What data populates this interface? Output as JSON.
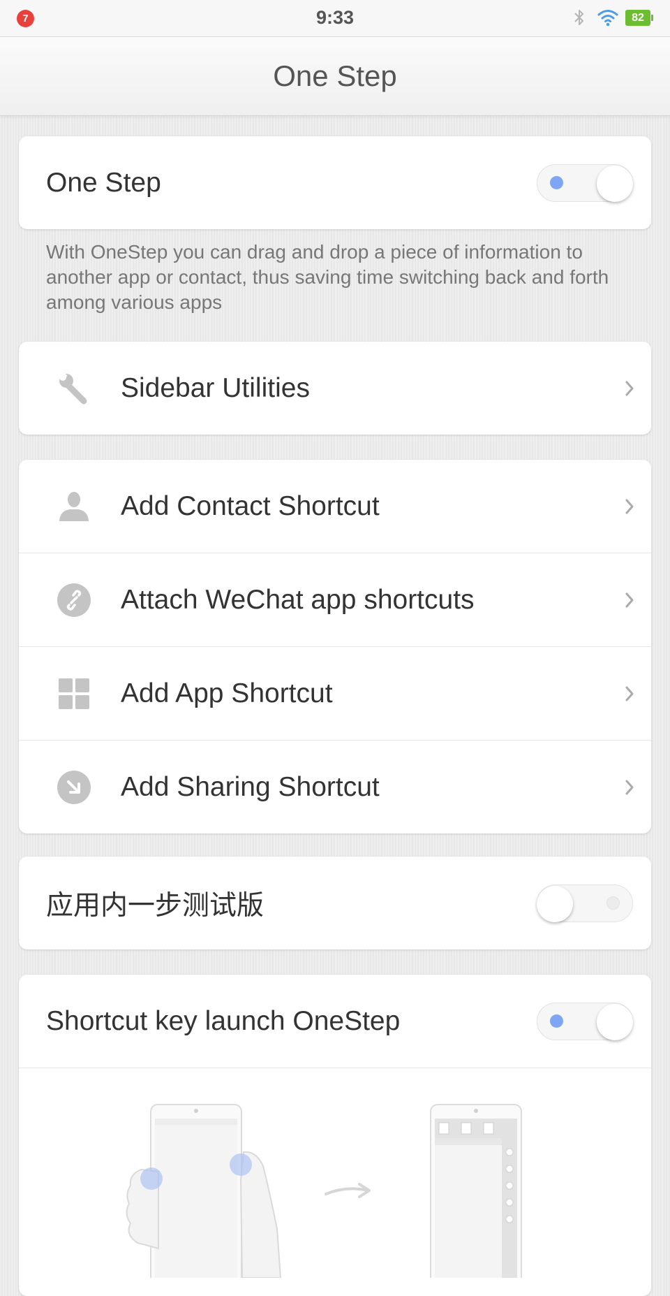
{
  "status_bar": {
    "notification_count": "7",
    "time": "9:33",
    "battery_level": "82",
    "icons": [
      "bluetooth-icon",
      "wifi-icon",
      "battery-icon"
    ]
  },
  "header": {
    "title": "One Step"
  },
  "one_step": {
    "label": "One Step",
    "toggle_state": "on",
    "description": "With OneStep you can drag and drop a piece of information to another app or contact, thus saving time switching back and forth among various apps"
  },
  "utilities": {
    "items": [
      {
        "label": "Sidebar Utilities",
        "icon": "wrench-icon"
      }
    ]
  },
  "shortcuts": {
    "items": [
      {
        "label": "Add Contact Shortcut",
        "icon": "person-icon"
      },
      {
        "label": "Attach WeChat app shortcuts",
        "icon": "link-icon"
      },
      {
        "label": "Add App Shortcut",
        "icon": "grid-icon"
      },
      {
        "label": "Add Sharing Shortcut",
        "icon": "share-arrow-icon"
      }
    ]
  },
  "in_app_beta": {
    "label": "应用内一步测试版",
    "toggle_state": "off"
  },
  "shortcut_key": {
    "label": "Shortcut key launch OneStep",
    "toggle_state": "on"
  },
  "colors": {
    "accent_blue": "#7fa6f5",
    "battery_green": "#6cbd2f",
    "badge_red": "#e8413c",
    "icon_gray": "#c2c2c2"
  }
}
